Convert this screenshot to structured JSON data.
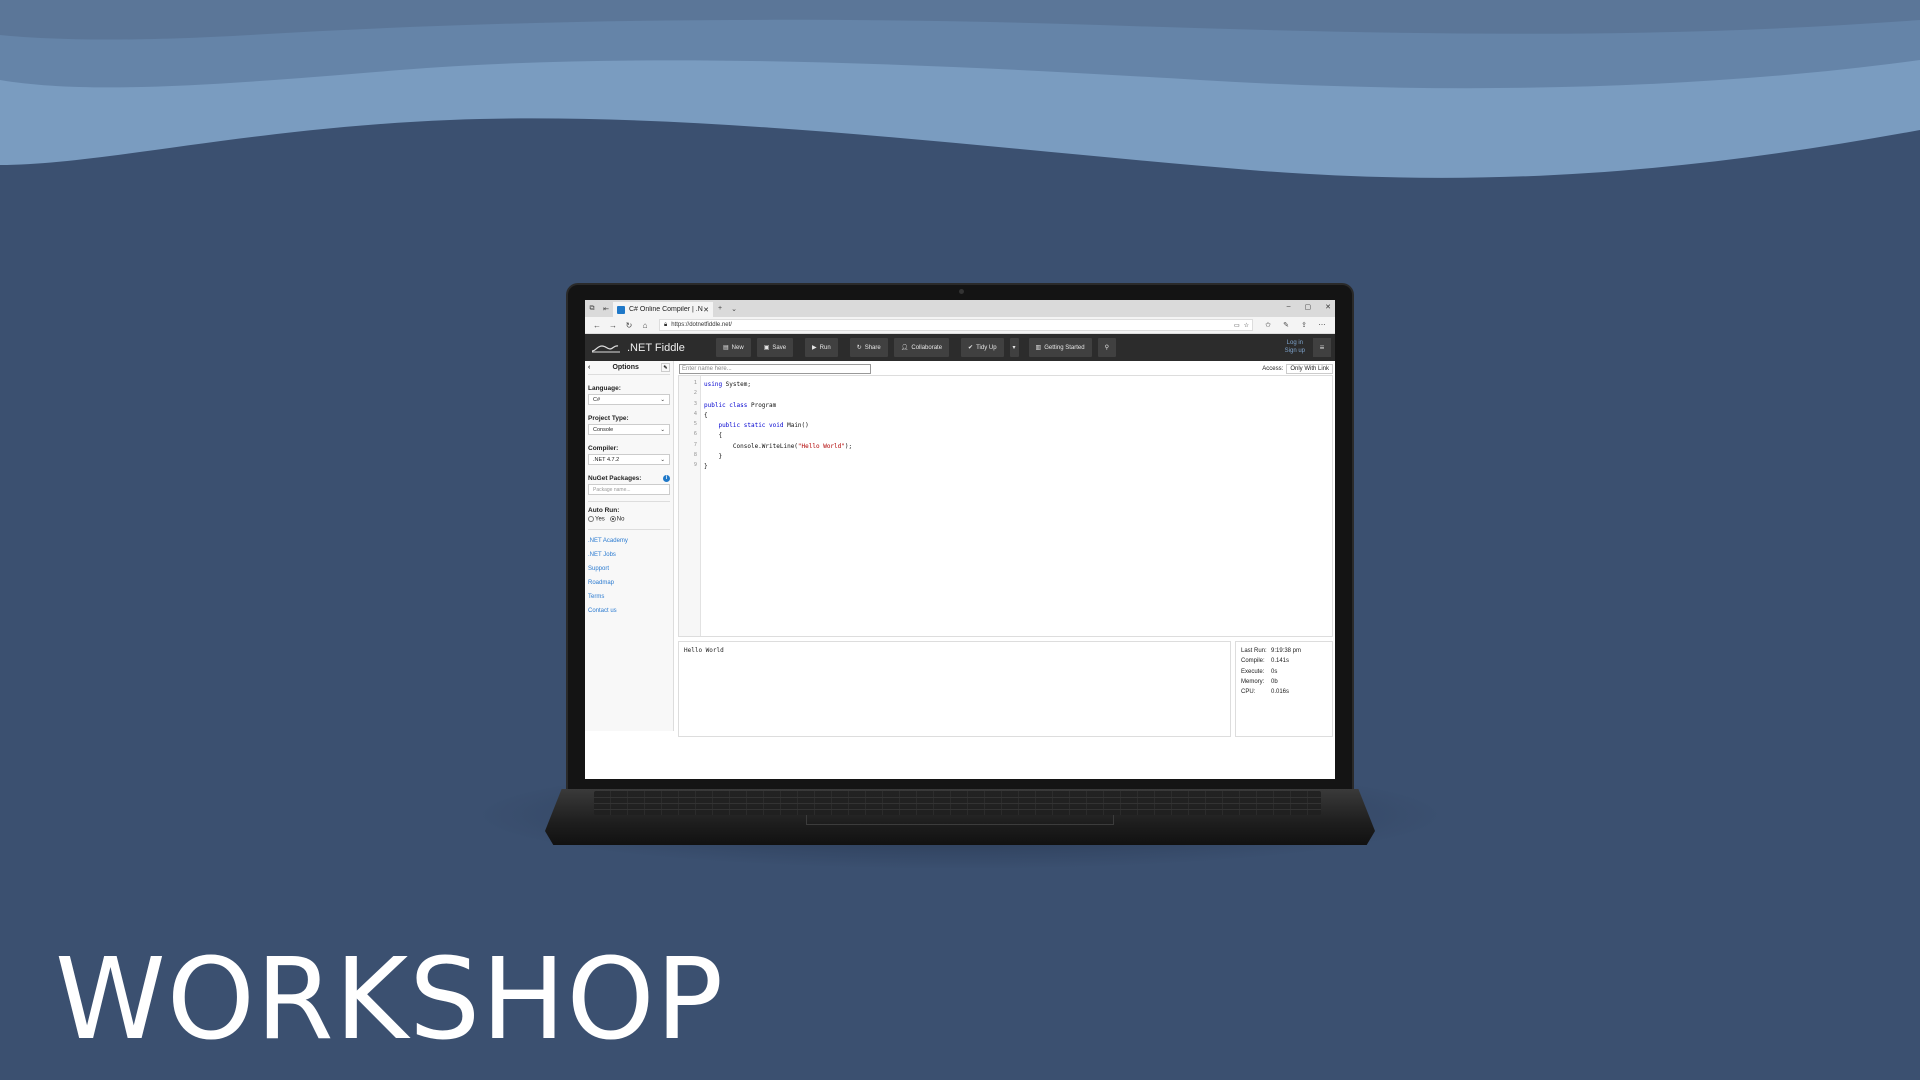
{
  "colors": {
    "background": "#3b5070",
    "wave_light": "#7a9cc0",
    "wave_mid": "#6584a8",
    "fiddle_header": "#2c2c2c",
    "link": "#2a7ad0",
    "keyword": "#0000d0",
    "string": "#b00000"
  },
  "slide": {
    "title": "WORKSHOP"
  },
  "browser": {
    "tab_title": "C# Online Compiler | .N",
    "new_tab": "+",
    "tab_list": "⌄",
    "url": "https://dotnetfiddle.net/",
    "window_controls": [
      "–",
      "▢",
      "✕"
    ],
    "icons": [
      "tab-actions-icon",
      "back-icon",
      "forward-icon",
      "refresh-icon",
      "home-icon",
      "lock-icon",
      "favorite-icon",
      "favorites-icon",
      "pen-icon",
      "share-icon",
      "more-icon"
    ]
  },
  "fiddle": {
    "logo_text": ".NET Fiddle",
    "buttons": {
      "new": "New",
      "save": "Save",
      "run": "Run",
      "share": "Share",
      "collaborate": "Collaborate",
      "tidy_up": "Tidy Up",
      "getting_started": "Getting Started"
    },
    "login": "Log in",
    "signup": "Sign up",
    "sidebar": {
      "header": "Options",
      "language_label": "Language:",
      "language_value": "C#",
      "project_type_label": "Project Type:",
      "project_type_value": "Console",
      "compiler_label": "Compiler:",
      "compiler_value": ".NET 4.7.2",
      "nuget_label": "NuGet Packages:",
      "nuget_placeholder": "Package name...",
      "autorun_label": "Auto Run:",
      "autorun_yes": "Yes",
      "autorun_no": "No",
      "autorun_selected": "No",
      "links": [
        ".NET Academy",
        ".NET Jobs",
        "Support",
        "Roadmap",
        "Terms",
        "Contact us"
      ]
    },
    "name_placeholder": "Enter name here...",
    "access_label": "Access:",
    "access_value": "Only With Link",
    "code_lines": [
      {
        "n": "1",
        "parts": [
          {
            "t": "using",
            "c": "kw"
          },
          {
            "t": " System;",
            "c": ""
          }
        ]
      },
      {
        "n": "2",
        "parts": []
      },
      {
        "n": "3",
        "parts": [
          {
            "t": "public class",
            "c": "kw"
          },
          {
            "t": " Program",
            "c": ""
          }
        ]
      },
      {
        "n": "4",
        "parts": [
          {
            "t": "{",
            "c": ""
          }
        ]
      },
      {
        "n": "5",
        "parts": [
          {
            "t": "    ",
            "c": ""
          },
          {
            "t": "public static void",
            "c": "kw"
          },
          {
            "t": " Main()",
            "c": ""
          }
        ]
      },
      {
        "n": "6",
        "parts": [
          {
            "t": "    {",
            "c": ""
          }
        ]
      },
      {
        "n": "7",
        "parts": [
          {
            "t": "        Console.WriteLine(",
            "c": ""
          },
          {
            "t": "\"Hello World\"",
            "c": "str"
          },
          {
            "t": ");",
            "c": ""
          }
        ]
      },
      {
        "n": "8",
        "parts": [
          {
            "t": "    }",
            "c": ""
          }
        ]
      },
      {
        "n": "9",
        "parts": [
          {
            "t": "}",
            "c": ""
          }
        ]
      }
    ],
    "output": "Hello World",
    "stats": [
      {
        "k": "Last Run:",
        "v": "9:19:38 pm"
      },
      {
        "k": "Compile:",
        "v": "0.141s"
      },
      {
        "k": "Execute:",
        "v": "0s"
      },
      {
        "k": "Memory:",
        "v": "0b"
      },
      {
        "k": "CPU:",
        "v": "0.016s"
      }
    ]
  }
}
